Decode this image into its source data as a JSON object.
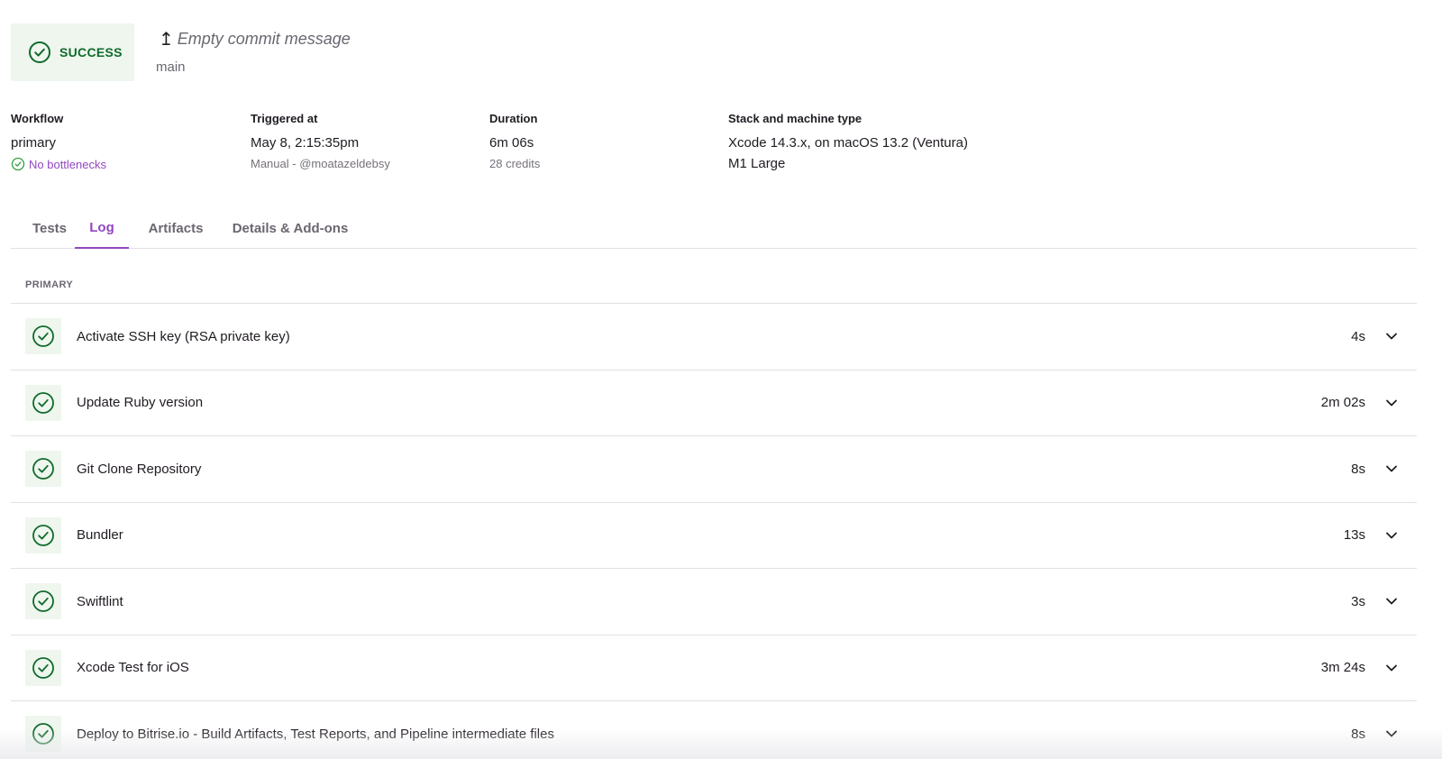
{
  "status": {
    "label": "SUCCESS",
    "icon": "check-circle-icon",
    "color": "#0f6a2a"
  },
  "commit": {
    "arrow": "↥",
    "message": "Empty commit message",
    "branch": "main"
  },
  "meta": {
    "workflow": {
      "label": "Workflow",
      "value": "primary",
      "sub": "No bottlenecks"
    },
    "triggered": {
      "label": "Triggered at",
      "value": "May 8, 2:15:35pm",
      "sub": "Manual - @moatazeldebsy"
    },
    "duration": {
      "label": "Duration",
      "value": "6m 06s",
      "sub": "28 credits"
    },
    "stack": {
      "label": "Stack and machine type",
      "value": "Xcode 14.3.x, on macOS 13.2 (Ventura)",
      "value2": "M1 Large"
    }
  },
  "tabs": [
    {
      "label": "Tests",
      "active": false
    },
    {
      "label": "Log",
      "active": true
    },
    {
      "label": "Artifacts",
      "active": false
    },
    {
      "label": "Details & Add-ons",
      "active": false
    }
  ],
  "section": {
    "label": "PRIMARY"
  },
  "steps": [
    {
      "title": "Activate SSH key (RSA private key)",
      "duration": "4s"
    },
    {
      "title": "Update Ruby version",
      "duration": "2m 02s"
    },
    {
      "title": "Git Clone Repository",
      "duration": "8s"
    },
    {
      "title": "Bundler",
      "duration": "13s"
    },
    {
      "title": "Swiftlint",
      "duration": "3s"
    },
    {
      "title": "Xcode Test for iOS",
      "duration": "3m 24s"
    },
    {
      "title": "Deploy to Bitrise.io - Build Artifacts, Test Reports, and Pipeline intermediate files",
      "duration": "8s"
    }
  ],
  "colors": {
    "accent": "#9247c2",
    "success": "#0f6a2a",
    "success_bg": "#eef6ee"
  }
}
